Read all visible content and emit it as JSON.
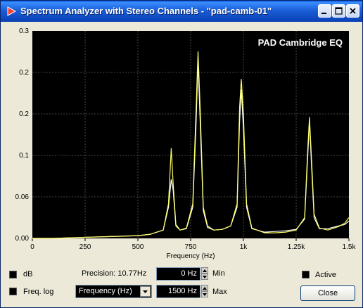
{
  "window": {
    "title": "Spectrum Analyzer with Stereo Channels - \"pad-camb-01\"",
    "buttons": [
      "minimize",
      "maximize",
      "close"
    ]
  },
  "chart_data": {
    "type": "line",
    "title": "",
    "overlay_label": "PAD Cambridge EQ",
    "xlabel": "Frequency (Hz)",
    "ylabel": "",
    "xlim": [
      0,
      1500
    ],
    "ylim": [
      0,
      0.3
    ],
    "x_ticks": [
      "0",
      "250",
      "500",
      "750",
      "1k",
      "1.25k",
      "1.5k"
    ],
    "y_ticks": [
      "0.00",
      "0.06",
      "0.1",
      "0.2",
      "0.2",
      "0.3"
    ],
    "grid": true,
    "series": [
      {
        "color": "#ffff66",
        "points": [
          [
            0,
            0
          ],
          [
            100,
            0
          ],
          [
            200,
            0.001
          ],
          [
            300,
            0.002
          ],
          [
            400,
            0.003
          ],
          [
            500,
            0.004
          ],
          [
            560,
            0.006
          ],
          [
            620,
            0.012
          ],
          [
            645,
            0.05
          ],
          [
            658,
            0.13
          ],
          [
            667,
            0.08
          ],
          [
            680,
            0.02
          ],
          [
            700,
            0.012
          ],
          [
            730,
            0.015
          ],
          [
            760,
            0.05
          ],
          [
            775,
            0.18
          ],
          [
            785,
            0.27
          ],
          [
            795,
            0.19
          ],
          [
            810,
            0.045
          ],
          [
            830,
            0.018
          ],
          [
            860,
            0.012
          ],
          [
            900,
            0.013
          ],
          [
            940,
            0.018
          ],
          [
            970,
            0.05
          ],
          [
            982,
            0.19
          ],
          [
            990,
            0.23
          ],
          [
            1000,
            0.18
          ],
          [
            1015,
            0.05
          ],
          [
            1040,
            0.015
          ],
          [
            1100,
            0.008
          ],
          [
            1150,
            0.008
          ],
          [
            1200,
            0.009
          ],
          [
            1250,
            0.012
          ],
          [
            1290,
            0.03
          ],
          [
            1305,
            0.13
          ],
          [
            1313,
            0.175
          ],
          [
            1322,
            0.12
          ],
          [
            1335,
            0.035
          ],
          [
            1360,
            0.015
          ],
          [
            1400,
            0.012
          ],
          [
            1450,
            0.017
          ],
          [
            1480,
            0.022
          ],
          [
            1500,
            0.03
          ]
        ]
      },
      {
        "color": "#ffffff",
        "points": [
          [
            0,
            0
          ],
          [
            100,
            0
          ],
          [
            200,
            0.001
          ],
          [
            300,
            0.002
          ],
          [
            400,
            0.003
          ],
          [
            500,
            0.004
          ],
          [
            560,
            0.006
          ],
          [
            620,
            0.012
          ],
          [
            645,
            0.045
          ],
          [
            658,
            0.085
          ],
          [
            667,
            0.07
          ],
          [
            680,
            0.018
          ],
          [
            700,
            0.012
          ],
          [
            730,
            0.014
          ],
          [
            760,
            0.045
          ],
          [
            775,
            0.16
          ],
          [
            785,
            0.255
          ],
          [
            795,
            0.17
          ],
          [
            810,
            0.04
          ],
          [
            830,
            0.016
          ],
          [
            860,
            0.012
          ],
          [
            900,
            0.013
          ],
          [
            940,
            0.018
          ],
          [
            970,
            0.045
          ],
          [
            982,
            0.17
          ],
          [
            990,
            0.215
          ],
          [
            1000,
            0.16
          ],
          [
            1015,
            0.045
          ],
          [
            1040,
            0.014
          ],
          [
            1100,
            0.009
          ],
          [
            1150,
            0.01
          ],
          [
            1200,
            0.011
          ],
          [
            1250,
            0.013
          ],
          [
            1290,
            0.028
          ],
          [
            1305,
            0.12
          ],
          [
            1313,
            0.17
          ],
          [
            1322,
            0.11
          ],
          [
            1335,
            0.03
          ],
          [
            1360,
            0.014
          ],
          [
            1400,
            0.014
          ],
          [
            1450,
            0.018
          ],
          [
            1480,
            0.02
          ],
          [
            1500,
            0.025
          ]
        ]
      }
    ]
  },
  "controls": {
    "db_label": "dB",
    "freq_log_label": "Freq. log",
    "precision_label": "Precision: 10.77Hz",
    "min_value": "0 Hz",
    "min_label": "Min",
    "max_value": "1500 Hz",
    "max_label": "Max",
    "axis_select_value": "Frequency (Hz)",
    "active_label": "Active",
    "close_label": "Close"
  },
  "colors": {
    "plot_background": "#000000",
    "grid": "#5a5a5a",
    "title_bar": "#0a3fb4"
  }
}
